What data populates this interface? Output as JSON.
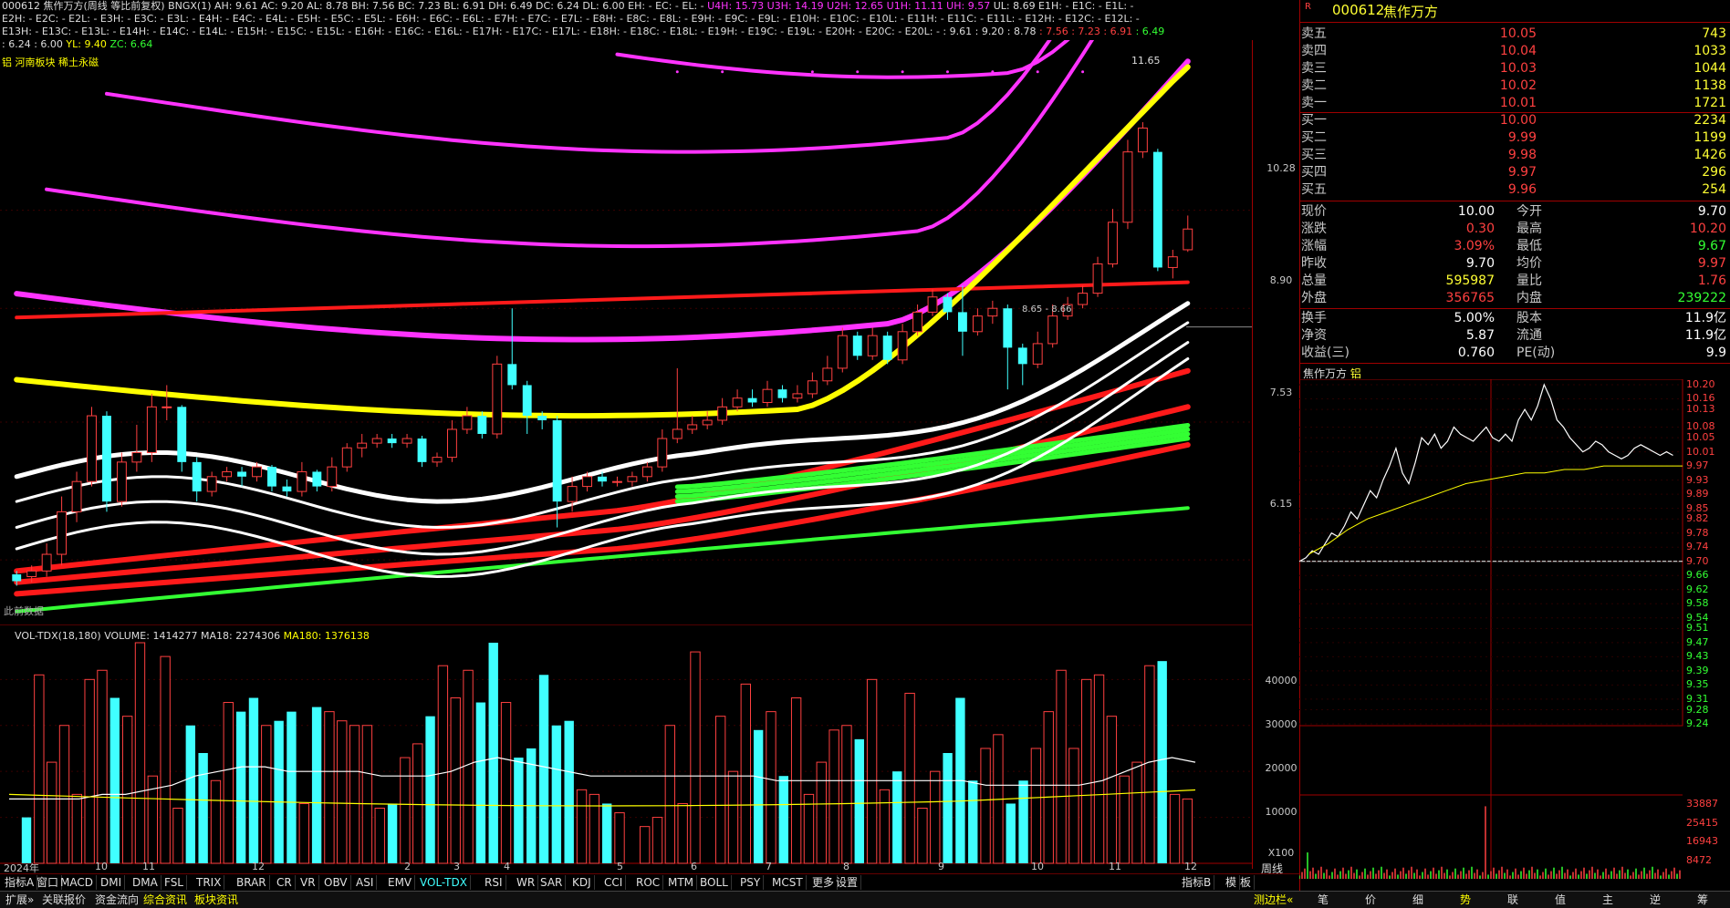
{
  "header": {
    "line1": "000612 焦作万方(周线 等比前复权)  BNGX(1) AH: 9.61  AC: 9.20  AL: 8.78  BH: 7.56  BC: 7.23  BL: 6.91  DH: 6.49  DC: 6.24  DL: 6.00  EH: -  EC: -  EL: -",
    "line1_m": "U4H: 15.73  U3H: 14.19  U2H: 12.65  U1H: 11.11  UH: 9.57",
    "line1_tail": "UL: 8.69  E1H: -  E1C: -  E1L: -",
    "line2": "E2H: -  E2C: -  E2L: -  E3H: -  E3C: -  E3L: -  E4H: -  E4C: -  E4L: -  E5H: -  E5C: -  E5L: -  E6H: -  E6C: -  E6L: -  E7H: -  E7C: -  E7L: -  E8H: -  E8C: -  E8L: -  E9H: -  E9C: -  E9L: -  E10H: -  E10C: -  E10L: -  E11H: -  E11C: -  E11L: -  E12H: -  E12C: -  E12L: -",
    "line3": "E13H: -  E13C: -  E13L: -  E14H: -  E14C: -  E14L: -  E15H: -  E15C: -  E15L: -  E16H: -  E16C: -  E16L: -  E17H: -  E17C: -  E17L: -  E18H: -  E18C: -  E18L: -  E19H: -  E19C: -  E19L: -  E20H: -  E20C: -  E20L: -  : 9.61  : 9.20  : 8.78",
    "line3_r": ": 7.56  : 7.23  : 6.91",
    "line3_g": ": 6.49",
    "line4_w": ": 6.24  : 6.00",
    "line4_y": "YL: 9.40",
    "line4_g": "ZC: 6.64",
    "sector": "铝 河南板块 稀土永磁"
  },
  "price_axis": [
    "10.28",
    "8.90",
    "7.53",
    "6.15"
  ],
  "max_label": "11.65",
  "lowdata": "此前数据",
  "cursor_label": "8.65 - 8.66",
  "vol_header": {
    "title": "VOL-TDX(18,180)",
    "volume": "VOLUME: 1414277",
    "ma18": "MA18: 2274306",
    "ma180": "MA180: 1376138"
  },
  "vol_axis": [
    "40000",
    "30000",
    "20000",
    "10000"
  ],
  "vol_unit": "X100",
  "x_labels": [
    "2024年",
    "10",
    "11",
    "12",
    "2",
    "3",
    "4",
    "5",
    "6",
    "7",
    "8",
    "9",
    "10",
    "11",
    "12"
  ],
  "period": "周线",
  "indicator_tabs": [
    "指标A",
    "窗口",
    "MACD",
    "DMI",
    "DMA",
    "FSL",
    "TRIX",
    "BRAR",
    "CR",
    "VR",
    "OBV",
    "ASI",
    "EMV",
    "VOL-TDX",
    "RSI",
    "WR",
    "SAR",
    "KDJ",
    "CCI",
    "ROC",
    "MTM",
    "BOLL",
    "PSY",
    "MCST",
    "更多",
    "设置"
  ],
  "indicator_right": [
    "指标B",
    "模",
    "板"
  ],
  "status_tabs": [
    "扩展»",
    "关联报价",
    "资金流向",
    "综合资讯",
    "板块资讯"
  ],
  "status_right": "测边栏«",
  "quote": {
    "code": "000612",
    "name": "焦作万方",
    "logo": "R",
    "asks": [
      {
        "label": "卖五",
        "price": "10.05",
        "vol": "743"
      },
      {
        "label": "卖四",
        "price": "10.04",
        "vol": "1033"
      },
      {
        "label": "卖三",
        "price": "10.03",
        "vol": "1044"
      },
      {
        "label": "卖二",
        "price": "10.02",
        "vol": "1138"
      },
      {
        "label": "卖一",
        "price": "10.01",
        "vol": "1721"
      }
    ],
    "bids": [
      {
        "label": "买一",
        "price": "10.00",
        "vol": "2234"
      },
      {
        "label": "买二",
        "price": "9.99",
        "vol": "1199"
      },
      {
        "label": "买三",
        "price": "9.98",
        "vol": "1426"
      },
      {
        "label": "买四",
        "price": "9.97",
        "vol": "296"
      },
      {
        "label": "买五",
        "price": "9.96",
        "vol": "254"
      }
    ],
    "stats": [
      {
        "l1": "现价",
        "v1": "10.00",
        "l2": "今开",
        "v2": "9.70",
        "c1": "#ffffff",
        "c2": "#ffffff"
      },
      {
        "l1": "涨跌",
        "v1": "0.30",
        "l2": "最高",
        "v2": "10.20",
        "c1": "#ff4040",
        "c2": "#ff4040"
      },
      {
        "l1": "涨幅",
        "v1": "3.09%",
        "l2": "最低",
        "v2": "9.67",
        "c1": "#ff4040",
        "c2": "#33ff33"
      },
      {
        "l1": "昨收",
        "v1": "9.70",
        "l2": "均价",
        "v2": "9.97",
        "c1": "#ffffff",
        "c2": "#ff4040"
      },
      {
        "l1": "总量",
        "v1": "595987",
        "l2": "量比",
        "v2": "1.76",
        "c1": "#ffff33",
        "c2": "#ff4040"
      },
      {
        "l1": "外盘",
        "v1": "356765",
        "l2": "内盘",
        "v2": "239222",
        "c1": "#ff4040",
        "c2": "#33ff33"
      }
    ],
    "stats2": [
      {
        "l1": "换手",
        "v1": "5.00%",
        "l2": "股本",
        "v2": "11.9亿"
      },
      {
        "l1": "净资",
        "v1": "5.87",
        "l2": "流通",
        "v2": "11.9亿"
      },
      {
        "l1": "收益(三)",
        "v1": "0.760",
        "l2": "PE(动)",
        "v2": "9.9"
      }
    ]
  },
  "intraday": {
    "title": "焦作万方",
    "tag": "铝",
    "axis": [
      "10.20",
      "10.16",
      "10.13",
      "10.08",
      "10.05",
      "10.01",
      "9.97",
      "9.93",
      "9.89",
      "9.85",
      "9.82",
      "9.78",
      "9.74",
      "9.70",
      "9.66",
      "9.62",
      "9.58",
      "9.54",
      "9.51",
      "9.47",
      "9.43",
      "9.39",
      "9.35",
      "9.31",
      "9.28",
      "9.24"
    ],
    "vol_axis": [
      "33887",
      "25415",
      "16943",
      "8472"
    ],
    "tabs": [
      "笔",
      "价",
      "细",
      "势",
      "联",
      "值",
      "主",
      "逆",
      "筹"
    ],
    "active_tab": "势"
  },
  "colors": {
    "up": "#ff4040",
    "down": "#40ffff",
    "magenta": "#ff33ff",
    "yellow": "#ffff00",
    "green": "#33ff33",
    "red": "#ff1a1a"
  },
  "chart_data": {
    "type": "candlestick",
    "ylabel": "",
    "candles": [
      {
        "o": 6.02,
        "c": 5.96,
        "h": 6.05,
        "l": 5.92
      },
      {
        "o": 6.0,
        "c": 6.05,
        "h": 6.1,
        "l": 5.95
      },
      {
        "o": 6.05,
        "c": 6.2,
        "h": 6.3,
        "l": 6.0
      },
      {
        "o": 6.2,
        "c": 6.6,
        "h": 6.75,
        "l": 6.1
      },
      {
        "o": 6.6,
        "c": 6.9,
        "h": 7.0,
        "l": 6.5
      },
      {
        "o": 6.9,
        "c": 7.6,
        "h": 7.7,
        "l": 6.85
      },
      {
        "o": 7.6,
        "c": 6.7,
        "h": 7.65,
        "l": 6.6
      },
      {
        "o": 6.7,
        "c": 7.1,
        "h": 7.2,
        "l": 6.65
      },
      {
        "o": 7.1,
        "c": 7.2,
        "h": 7.5,
        "l": 7.0
      },
      {
        "o": 7.2,
        "c": 7.7,
        "h": 7.85,
        "l": 7.1
      },
      {
        "o": 7.7,
        "c": 7.7,
        "h": 7.95,
        "l": 7.55
      },
      {
        "o": 7.7,
        "c": 7.1,
        "h": 7.72,
        "l": 7.0
      },
      {
        "o": 7.1,
        "c": 6.8,
        "h": 7.15,
        "l": 6.7
      },
      {
        "o": 6.8,
        "c": 6.95,
        "h": 7.0,
        "l": 6.75
      },
      {
        "o": 6.95,
        "c": 7.0,
        "h": 7.05,
        "l": 6.9
      },
      {
        "o": 7.0,
        "c": 6.95,
        "h": 7.05,
        "l": 6.85
      },
      {
        "o": 6.95,
        "c": 7.05,
        "h": 7.1,
        "l": 6.9
      },
      {
        "o": 7.05,
        "c": 6.85,
        "h": 7.07,
        "l": 6.8
      },
      {
        "o": 6.85,
        "c": 6.8,
        "h": 6.92,
        "l": 6.75
      },
      {
        "o": 6.8,
        "c": 7.0,
        "h": 7.1,
        "l": 6.75
      },
      {
        "o": 7.0,
        "c": 6.85,
        "h": 7.02,
        "l": 6.8
      },
      {
        "o": 6.85,
        "c": 7.05,
        "h": 7.15,
        "l": 6.8
      },
      {
        "o": 7.05,
        "c": 7.25,
        "h": 7.3,
        "l": 7.0
      },
      {
        "o": 7.25,
        "c": 7.3,
        "h": 7.4,
        "l": 7.15
      },
      {
        "o": 7.3,
        "c": 7.35,
        "h": 7.4,
        "l": 7.25
      },
      {
        "o": 7.35,
        "c": 7.3,
        "h": 7.4,
        "l": 7.25
      },
      {
        "o": 7.3,
        "c": 7.35,
        "h": 7.4,
        "l": 7.25
      },
      {
        "o": 7.35,
        "c": 7.1,
        "h": 7.38,
        "l": 7.05
      },
      {
        "o": 7.1,
        "c": 7.15,
        "h": 7.2,
        "l": 7.05
      },
      {
        "o": 7.15,
        "c": 7.45,
        "h": 7.55,
        "l": 7.1
      },
      {
        "o": 7.45,
        "c": 7.6,
        "h": 7.7,
        "l": 7.4
      },
      {
        "o": 7.6,
        "c": 7.4,
        "h": 7.65,
        "l": 7.35
      },
      {
        "o": 7.4,
        "c": 8.2,
        "h": 8.3,
        "l": 7.35
      },
      {
        "o": 8.2,
        "c": 7.95,
        "h": 8.9,
        "l": 7.9
      },
      {
        "o": 7.95,
        "c": 7.6,
        "h": 8.0,
        "l": 7.4
      },
      {
        "o": 7.6,
        "c": 7.55,
        "h": 7.65,
        "l": 7.45
      },
      {
        "o": 7.55,
        "c": 6.7,
        "h": 7.6,
        "l": 6.45
      },
      {
        "o": 6.7,
        "c": 6.85,
        "h": 6.95,
        "l": 6.6
      },
      {
        "o": 6.85,
        "c": 6.95,
        "h": 7.0,
        "l": 6.8
      },
      {
        "o": 6.95,
        "c": 6.9,
        "h": 7.0,
        "l": 6.85
      },
      {
        "o": 6.9,
        "c": 6.9,
        "h": 6.95,
        "l": 6.85
      },
      {
        "o": 6.9,
        "c": 6.95,
        "h": 7.0,
        "l": 6.85
      },
      {
        "o": 6.95,
        "c": 7.05,
        "h": 7.1,
        "l": 6.9
      },
      {
        "o": 7.05,
        "c": 7.35,
        "h": 7.45,
        "l": 7.0
      },
      {
        "o": 7.35,
        "c": 7.45,
        "h": 8.15,
        "l": 7.3
      },
      {
        "o": 7.45,
        "c": 7.5,
        "h": 7.6,
        "l": 7.4
      },
      {
        "o": 7.5,
        "c": 7.55,
        "h": 7.65,
        "l": 7.45
      },
      {
        "o": 7.55,
        "c": 7.7,
        "h": 7.8,
        "l": 7.5
      },
      {
        "o": 7.7,
        "c": 7.8,
        "h": 7.9,
        "l": 7.65
      },
      {
        "o": 7.8,
        "c": 7.75,
        "h": 7.9,
        "l": 7.7
      },
      {
        "o": 7.75,
        "c": 7.9,
        "h": 8.0,
        "l": 7.7
      },
      {
        "o": 7.9,
        "c": 7.8,
        "h": 7.95,
        "l": 7.75
      },
      {
        "o": 7.8,
        "c": 7.85,
        "h": 7.95,
        "l": 7.75
      },
      {
        "o": 7.85,
        "c": 8.0,
        "h": 8.1,
        "l": 7.8
      },
      {
        "o": 8.0,
        "c": 8.15,
        "h": 8.3,
        "l": 7.95
      },
      {
        "o": 8.15,
        "c": 8.55,
        "h": 8.65,
        "l": 8.1
      },
      {
        "o": 8.55,
        "c": 8.3,
        "h": 8.6,
        "l": 8.25
      },
      {
        "o": 8.3,
        "c": 8.55,
        "h": 8.65,
        "l": 8.25
      },
      {
        "o": 8.55,
        "c": 8.25,
        "h": 8.6,
        "l": 8.2
      },
      {
        "o": 8.25,
        "c": 8.6,
        "h": 8.7,
        "l": 8.2
      },
      {
        "o": 8.6,
        "c": 8.85,
        "h": 8.95,
        "l": 8.55
      },
      {
        "o": 8.85,
        "c": 9.05,
        "h": 9.15,
        "l": 8.8
      },
      {
        "o": 9.05,
        "c": 8.85,
        "h": 9.1,
        "l": 8.75
      },
      {
        "o": 8.85,
        "c": 8.6,
        "h": 9.2,
        "l": 8.3
      },
      {
        "o": 8.6,
        "c": 8.8,
        "h": 8.9,
        "l": 8.55
      },
      {
        "o": 8.8,
        "c": 8.9,
        "h": 9.0,
        "l": 8.7
      },
      {
        "o": 8.9,
        "c": 8.4,
        "h": 8.95,
        "l": 7.9
      },
      {
        "o": 8.4,
        "c": 8.2,
        "h": 8.45,
        "l": 7.95
      },
      {
        "o": 8.2,
        "c": 8.45,
        "h": 8.6,
        "l": 8.15
      },
      {
        "o": 8.45,
        "c": 8.8,
        "h": 8.95,
        "l": 8.4
      },
      {
        "o": 8.8,
        "c": 8.95,
        "h": 9.05,
        "l": 8.75
      },
      {
        "o": 8.95,
        "c": 9.1,
        "h": 9.2,
        "l": 8.9
      },
      {
        "o": 9.1,
        "c": 9.5,
        "h": 9.6,
        "l": 9.05
      },
      {
        "o": 9.5,
        "c": 10.1,
        "h": 10.3,
        "l": 9.45
      },
      {
        "o": 10.1,
        "c": 11.2,
        "h": 11.4,
        "l": 10.0
      },
      {
        "o": 11.2,
        "c": 11.6,
        "h": 11.7,
        "l": 11.1
      },
      {
        "o": 11.2,
        "c": 9.45,
        "h": 11.25,
        "l": 9.4
      },
      {
        "o": 9.45,
        "c": 9.6,
        "h": 9.7,
        "l": 9.3
      },
      {
        "o": 9.7,
        "c": 10.0,
        "h": 10.2,
        "l": 9.67
      }
    ],
    "volumes": [
      0,
      1000,
      4100,
      2200,
      3000,
      1500,
      4000,
      4200,
      3600,
      3200,
      4800,
      1900,
      4500,
      1200,
      3000,
      2400,
      1800,
      3500,
      3300,
      3600,
      3000,
      3100,
      3300,
      1300,
      3400,
      3300,
      3100,
      3000,
      3000,
      1200,
      1300,
      2300,
      2600,
      3200,
      4300,
      3600,
      4200,
      3500,
      4800,
      3500,
      2300,
      2500,
      4100,
      3000,
      3100,
      1600,
      1500,
      1300,
      1100,
      0,
      800,
      1000,
      3000,
      1300,
      4600,
      0,
      3200,
      2000,
      3900,
      2900,
      3300,
      1900,
      3600,
      1500,
      2200,
      2900,
      3000,
      2700,
      4000,
      1600,
      2000,
      3700,
      1200,
      2000,
      2400,
      3600,
      1800,
      2500,
      2800,
      1300,
      1800,
      2500,
      3300,
      4200,
      2500,
      4000,
      4100,
      3200,
      1900,
      2200,
      4300,
      4400,
      1500,
      1400
    ],
    "vol_ma18": [
      14,
      14,
      14,
      14,
      15,
      15,
      16,
      17,
      19,
      20,
      21,
      21,
      20,
      20,
      20,
      20,
      19,
      19,
      19,
      20,
      22,
      23,
      22,
      21,
      20,
      19,
      19,
      19,
      19,
      19,
      19,
      19,
      19,
      18,
      18,
      18,
      18,
      18,
      18,
      18,
      18,
      18,
      17,
      17,
      17,
      17,
      17,
      18,
      20,
      22,
      23,
      22
    ],
    "intraday": [
      9.7,
      9.71,
      9.73,
      9.72,
      9.75,
      9.78,
      9.77,
      9.8,
      9.84,
      9.82,
      9.86,
      9.9,
      9.88,
      9.93,
      9.97,
      10.02,
      9.95,
      9.92,
      9.98,
      10.05,
      10.03,
      10.06,
      10.02,
      10.04,
      10.08,
      10.06,
      10.05,
      10.04,
      10.06,
      10.08,
      10.05,
      10.04,
      10.06,
      10.04,
      10.1,
      10.13,
      10.1,
      10.14,
      10.2,
      10.16,
      10.1,
      10.08,
      10.05,
      10.03,
      10.01,
      10.02,
      10.04,
      10.03,
      10.01,
      10.0,
      9.99,
      10.0,
      10.02,
      10.03,
      10.02,
      10.01,
      10.0,
      10.01,
      10.0
    ],
    "intraday_avg": [
      9.72,
      9.75,
      9.79,
      9.82,
      9.84,
      9.86,
      9.88,
      9.9,
      9.92,
      9.93,
      9.94,
      9.95,
      9.95,
      9.96,
      9.96,
      9.97,
      9.97,
      9.97,
      9.97,
      9.97
    ]
  }
}
